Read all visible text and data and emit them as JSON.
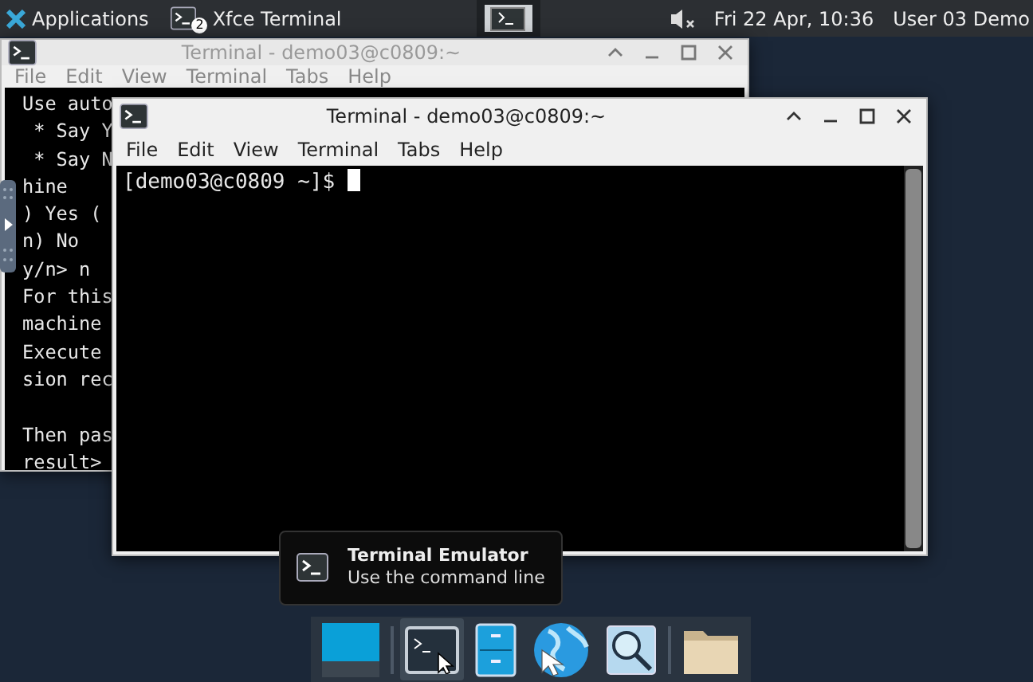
{
  "top_panel": {
    "applications": "Applications",
    "task": {
      "label": "Xfce Terminal",
      "count": "2"
    },
    "clock": "Fri 22 Apr, 10:36",
    "user": "User 03 Demo"
  },
  "windows": [
    {
      "title": "Terminal - demo03@c0809:~",
      "active": false,
      "menu": [
        "File",
        "Edit",
        "View",
        "Terminal",
        "Tabs",
        "Help"
      ],
      "blocks": [
        [
          "Use auto",
          " * Say Y",
          " * Say N",
          "hine",
          ") Yes (",
          "n) No",
          "y/n> n",
          "For this",
          "machine",
          "Execute",
          "sion rec"
        ],
        [
          "Then pas",
          "result>"
        ]
      ]
    },
    {
      "title": "Terminal - demo03@c0809:~",
      "active": true,
      "menu": [
        "File",
        "Edit",
        "View",
        "Terminal",
        "Tabs",
        "Help"
      ],
      "blocks": [
        [
          "[demo03@c0809 ~]$ "
        ]
      ]
    }
  ],
  "tooltip": {
    "title": "Terminal Emulator",
    "subtitle": "Use the command line"
  },
  "dock": [
    {
      "kind": "desktop",
      "selected": false
    },
    {
      "kind": "terminal",
      "selected": true
    },
    {
      "kind": "cabinet",
      "selected": false
    },
    {
      "kind": "globe",
      "selected": false
    },
    {
      "kind": "search",
      "selected": false
    },
    {
      "kind": "folder",
      "selected": false
    }
  ]
}
